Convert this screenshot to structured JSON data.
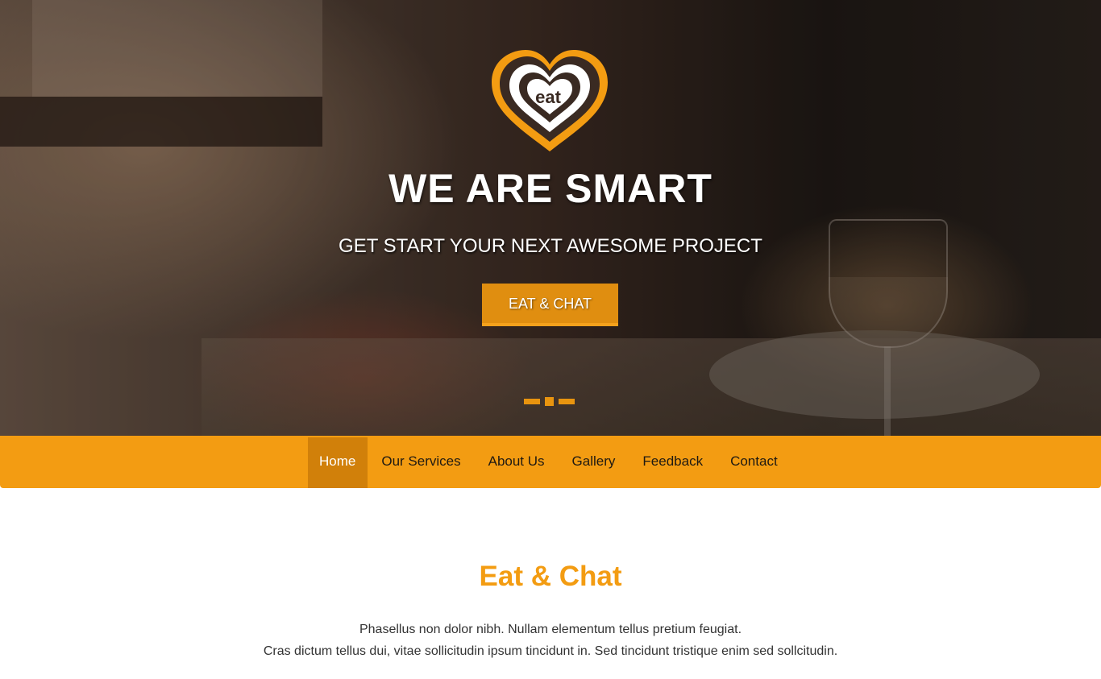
{
  "logo": {
    "text": "eat",
    "colors": {
      "outer": "#f39c12",
      "ring": "#3a2a22",
      "inner": "#ffffff"
    }
  },
  "hero": {
    "title": "WE ARE SMART",
    "subtitle": "GET START YOUR NEXT AWESOME PROJECT",
    "cta_label": "EAT & CHAT",
    "slides": {
      "count": 3,
      "active_index": 1
    }
  },
  "nav": {
    "items": [
      {
        "label": "Home",
        "active": true
      },
      {
        "label": "Our Services",
        "active": false
      },
      {
        "label": "About Us",
        "active": false
      },
      {
        "label": "Gallery",
        "active": false
      },
      {
        "label": "Feedback",
        "active": false
      },
      {
        "label": "Contact",
        "active": false
      }
    ]
  },
  "section": {
    "title": "Eat & Chat",
    "lines": [
      "Phasellus non dolor nibh. Nullam elementum tellus pretium feugiat.",
      "Cras dictum tellus dui, vitae sollicitudin ipsum tincidunt in. Sed tincidunt tristique enim sed sollcitudin."
    ]
  },
  "colors": {
    "accent": "#f39c12",
    "accent_dark": "#d1800a"
  }
}
